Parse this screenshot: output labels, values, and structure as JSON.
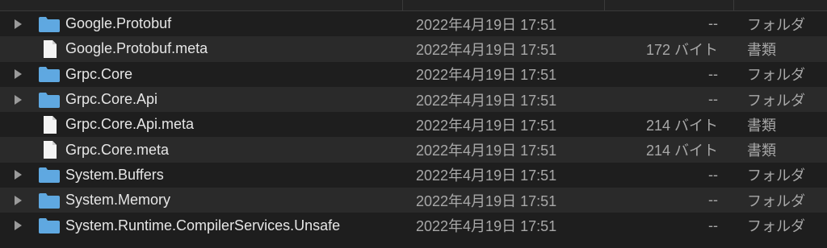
{
  "colors": {
    "background": "#1e1e1e",
    "row_alt": "#2a2a2a",
    "folder": "#5fa8e0",
    "text_primary": "#e6e6e6",
    "text_secondary": "#a8a8a8"
  },
  "files": [
    {
      "name": "Google.Protobuf",
      "date": "2022年4月19日 17:51",
      "size": "--",
      "kind": "フォルダ",
      "type": "folder"
    },
    {
      "name": "Google.Protobuf.meta",
      "date": "2022年4月19日 17:51",
      "size": "172 バイト",
      "kind": "書類",
      "type": "document"
    },
    {
      "name": "Grpc.Core",
      "date": "2022年4月19日 17:51",
      "size": "--",
      "kind": "フォルダ",
      "type": "folder"
    },
    {
      "name": "Grpc.Core.Api",
      "date": "2022年4月19日 17:51",
      "size": "--",
      "kind": "フォルダ",
      "type": "folder"
    },
    {
      "name": "Grpc.Core.Api.meta",
      "date": "2022年4月19日 17:51",
      "size": "214 バイト",
      "kind": "書類",
      "type": "document"
    },
    {
      "name": "Grpc.Core.meta",
      "date": "2022年4月19日 17:51",
      "size": "214 バイト",
      "kind": "書類",
      "type": "document"
    },
    {
      "name": "System.Buffers",
      "date": "2022年4月19日 17:51",
      "size": "--",
      "kind": "フォルダ",
      "type": "folder"
    },
    {
      "name": "System.Memory",
      "date": "2022年4月19日 17:51",
      "size": "--",
      "kind": "フォルダ",
      "type": "folder"
    },
    {
      "name": "System.Runtime.CompilerServices.Unsafe",
      "date": "2022年4月19日 17:51",
      "size": "--",
      "kind": "フォルダ",
      "type": "folder"
    }
  ]
}
